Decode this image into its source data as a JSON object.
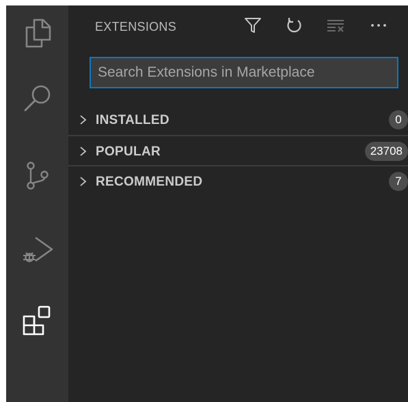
{
  "activity_bar": {
    "items": [
      {
        "icon": "explorer-icon"
      },
      {
        "icon": "search-icon"
      },
      {
        "icon": "source-control-icon"
      },
      {
        "icon": "run-debug-icon"
      },
      {
        "icon": "extensions-icon",
        "active": true
      }
    ]
  },
  "sidebar": {
    "title": "EXTENSIONS",
    "actions": [
      {
        "icon": "filter-icon"
      },
      {
        "icon": "refresh-icon"
      },
      {
        "icon": "clear-results-icon"
      },
      {
        "icon": "more-actions-icon"
      }
    ],
    "search": {
      "placeholder": "Search Extensions in Marketplace",
      "value": ""
    },
    "sections": [
      {
        "label": "INSTALLED",
        "count": "0",
        "expanded": false
      },
      {
        "label": "POPULAR",
        "count": "23708",
        "expanded": false
      },
      {
        "label": "RECOMMENDED",
        "count": "7",
        "expanded": false
      }
    ]
  },
  "colors": {
    "activity_bar_bg": "#333333",
    "sidebar_bg": "#252526",
    "focus_border": "#1177bb",
    "badge_bg": "#4d4d4d",
    "icon_active": "#ffffff",
    "icon_inactive": "#858585"
  }
}
